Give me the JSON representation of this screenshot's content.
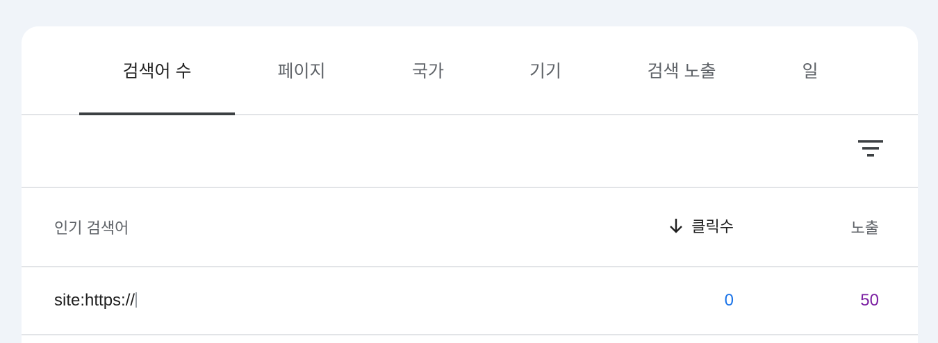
{
  "tabs": [
    {
      "label": "검색어 수",
      "active": true
    },
    {
      "label": "페이지",
      "active": false
    },
    {
      "label": "국가",
      "active": false
    },
    {
      "label": "기기",
      "active": false
    },
    {
      "label": "검색 노출",
      "active": false
    },
    {
      "label": "일",
      "active": false
    }
  ],
  "toolbar": {
    "filter_icon": "filter-icon"
  },
  "table": {
    "headers": {
      "query": "인기 검색어",
      "clicks": "클릭수",
      "impressions": "노출"
    },
    "sort": {
      "column": "clicks",
      "direction": "descending",
      "icon": "arrow-down-icon"
    },
    "rows": [
      {
        "query": "site:https://",
        "clicks": "0",
        "impressions": "50"
      }
    ]
  },
  "colors": {
    "clicks": "#1a73e8",
    "impressions": "#7b1fa2",
    "active_tab_indicator": "#3c4043",
    "background": "#f0f4f9"
  }
}
